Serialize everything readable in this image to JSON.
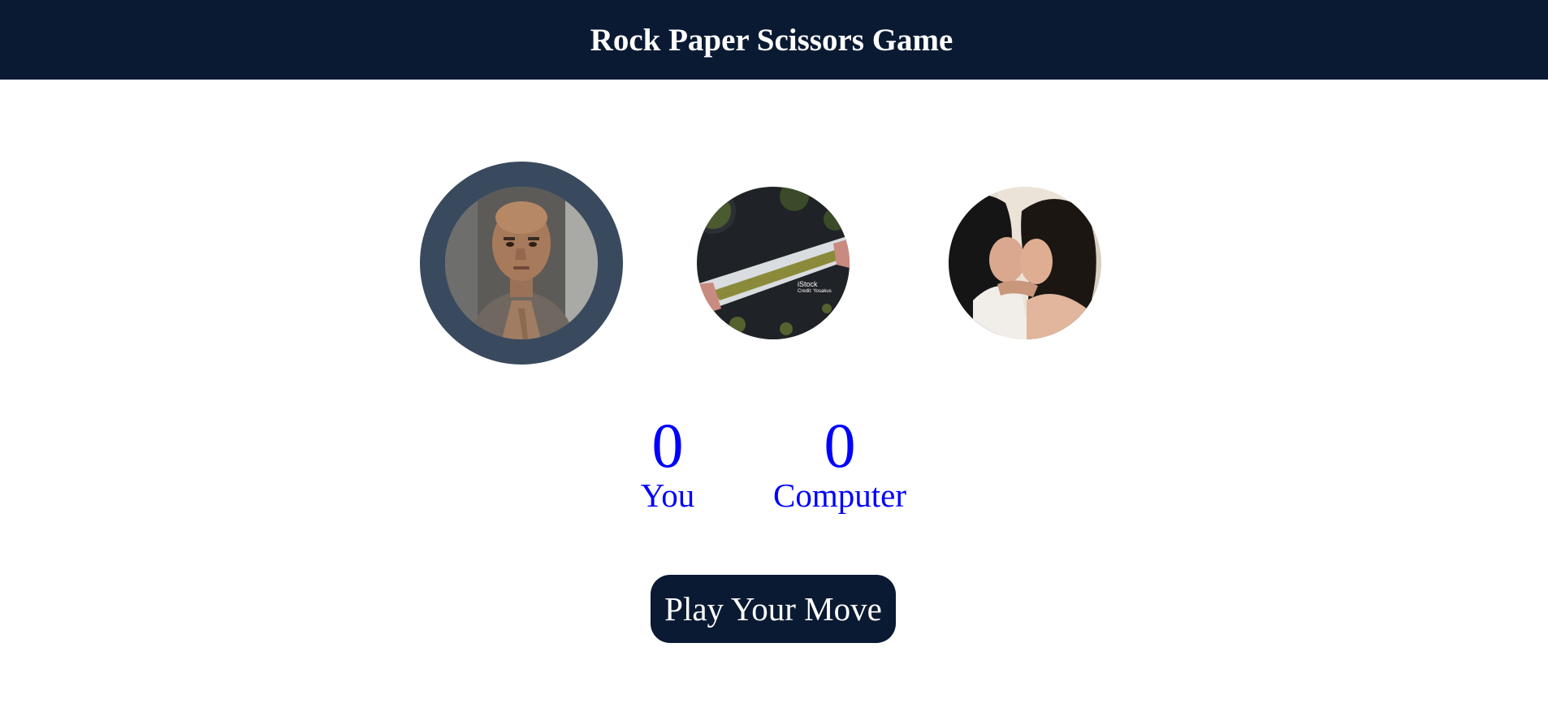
{
  "header": {
    "title": "Rock Paper Scissors Game"
  },
  "choices": [
    {
      "id": "rock",
      "selected": true
    },
    {
      "id": "paper",
      "selected": false,
      "watermark": "iStock",
      "watermark_sub": "Credit: Yosakus"
    },
    {
      "id": "scissors",
      "selected": false
    }
  ],
  "scores": {
    "user": {
      "value": "0",
      "label": "You"
    },
    "computer": {
      "value": "0",
      "label": "Computer"
    }
  },
  "actions": {
    "play_label": "Play Your Move"
  },
  "colors": {
    "header_bg": "#0a1a33",
    "selected_ring": "#394a5e",
    "score_text": "#0000ff",
    "button_bg": "#0a1a33"
  }
}
